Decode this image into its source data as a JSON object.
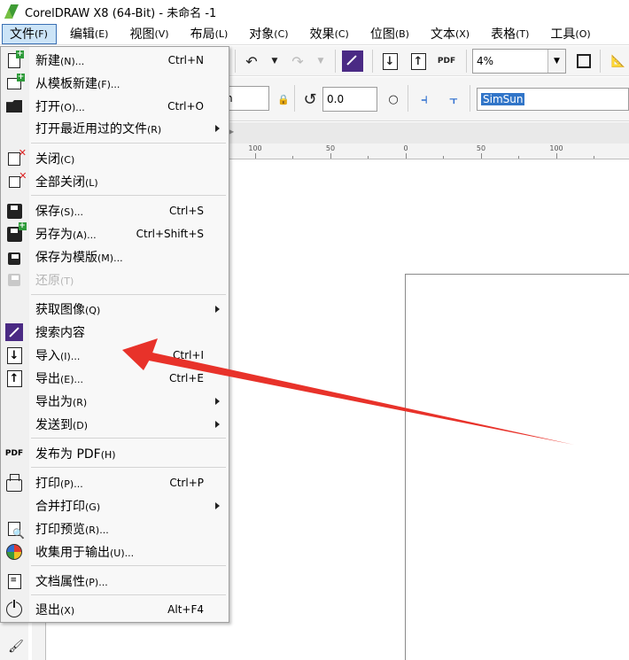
{
  "window": {
    "title": "CorelDRAW X8 (64-Bit) - 未命名 -1"
  },
  "menubar": [
    {
      "label": "文件",
      "acc": "(F)",
      "active": true
    },
    {
      "label": "编辑",
      "acc": "(E)"
    },
    {
      "label": "视图",
      "acc": "(V)"
    },
    {
      "label": "布局",
      "acc": "(L)"
    },
    {
      "label": "对象",
      "acc": "(C)"
    },
    {
      "label": "效果",
      "acc": "(C)"
    },
    {
      "label": "位图",
      "acc": "(B)"
    },
    {
      "label": "文本",
      "acc": "(X)"
    },
    {
      "label": "表格",
      "acc": "(T)"
    },
    {
      "label": "工具",
      "acc": "(O)"
    }
  ],
  "toolbar": {
    "zoom_value": "4%",
    "unit_value": "n",
    "rotation_value": "0.0",
    "font_name": "SimSun",
    "pdf_label": "PDF"
  },
  "ruler": {
    "labels": [
      "100",
      "50",
      "0",
      "50",
      "100"
    ]
  },
  "file_menu": {
    "items": [
      {
        "label": "新建",
        "acc": "(N)...",
        "shortcut": "Ctrl+N",
        "icon": "new-document-icon"
      },
      {
        "label": "从模板新建",
        "acc": "(F)...",
        "shortcut": "",
        "icon": ""
      },
      {
        "label": "打开",
        "acc": "(O)...",
        "shortcut": "Ctrl+O",
        "icon": "open-folder-icon"
      },
      {
        "label": "打开最近用过的文件",
        "acc": "(R)",
        "shortcut": "",
        "icon": "",
        "submenu": true
      },
      {
        "label": "关闭",
        "acc": "(C)",
        "shortcut": "",
        "icon": "close-document-icon"
      },
      {
        "label": "全部关闭",
        "acc": "(L)",
        "shortcut": "",
        "icon": "close-all-icon"
      },
      {
        "label": "保存",
        "acc": "(S)...",
        "shortcut": "Ctrl+S",
        "icon": "save-icon"
      },
      {
        "label": "另存为",
        "acc": "(A)...",
        "shortcut": "Ctrl+Shift+S",
        "icon": "save-as-icon"
      },
      {
        "label": "保存为模版",
        "acc": "(M)...",
        "shortcut": "",
        "icon": "save-template-icon"
      },
      {
        "label": "还原",
        "acc": "(T)",
        "shortcut": "",
        "icon": "revert-icon",
        "disabled": true
      },
      {
        "label": "获取图像",
        "acc": "(Q)",
        "shortcut": "",
        "icon": "",
        "submenu": true
      },
      {
        "label": "搜索内容",
        "acc": "",
        "shortcut": "",
        "icon": "search-content-icon"
      },
      {
        "label": "导入",
        "acc": "(I)...",
        "shortcut": "Ctrl+I",
        "icon": "import-icon"
      },
      {
        "label": "导出",
        "acc": "(E)...",
        "shortcut": "Ctrl+E",
        "icon": "export-icon"
      },
      {
        "label": "导出为",
        "acc": "(R)",
        "shortcut": "",
        "icon": "",
        "submenu": true
      },
      {
        "label": "发送到",
        "acc": "(D)",
        "shortcut": "",
        "icon": "",
        "submenu": true
      },
      {
        "label": "发布为 PDF",
        "acc": "(H)",
        "shortcut": "",
        "icon": "pdf-icon"
      },
      {
        "label": "打印",
        "acc": "(P)...",
        "shortcut": "Ctrl+P",
        "icon": "print-icon"
      },
      {
        "label": "合并打印",
        "acc": "(G)",
        "shortcut": "",
        "icon": "",
        "submenu": true
      },
      {
        "label": "打印预览",
        "acc": "(R)...",
        "shortcut": "",
        "icon": "print-preview-icon"
      },
      {
        "label": "收集用于输出",
        "acc": "(U)...",
        "shortcut": "",
        "icon": "collect-output-icon"
      },
      {
        "label": "文档属性",
        "acc": "(P)...",
        "shortcut": "",
        "icon": "document-properties-icon"
      },
      {
        "label": "退出",
        "acc": "(X)",
        "shortcut": "Alt+F4",
        "icon": "exit-icon"
      }
    ]
  },
  "colors": {
    "menu_highlight": "#cce4f7",
    "menu_highlight_border": "#3a6fb4",
    "annotation_arrow": "#e8322a",
    "search_icon_bg": "#4a2a84",
    "font_selected_bg": "#3175c8"
  }
}
